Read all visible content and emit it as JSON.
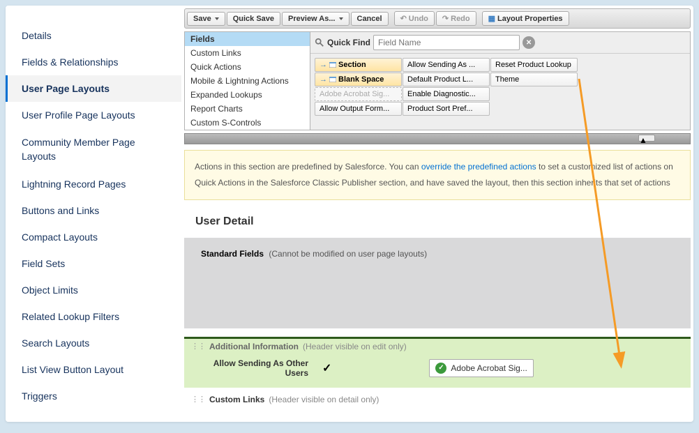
{
  "sidebar": {
    "items": [
      {
        "label": "Details",
        "active": false
      },
      {
        "label": "Fields & Relationships",
        "active": false
      },
      {
        "label": "User Page Layouts",
        "active": true
      },
      {
        "label": "User Profile Page Layouts",
        "active": false
      },
      {
        "label": "Community Member Page Layouts",
        "active": false,
        "multi": true
      },
      {
        "label": "Lightning Record Pages",
        "active": false
      },
      {
        "label": "Buttons and Links",
        "active": false
      },
      {
        "label": "Compact Layouts",
        "active": false
      },
      {
        "label": "Field Sets",
        "active": false
      },
      {
        "label": "Object Limits",
        "active": false
      },
      {
        "label": "Related Lookup Filters",
        "active": false
      },
      {
        "label": "Search Layouts",
        "active": false
      },
      {
        "label": "List View Button Layout",
        "active": false
      },
      {
        "label": "Triggers",
        "active": false
      }
    ]
  },
  "toolbar": {
    "save": "Save",
    "quick_save": "Quick Save",
    "preview_as": "Preview As...",
    "cancel": "Cancel",
    "undo": "Undo",
    "redo": "Redo",
    "layout_props": "Layout Properties"
  },
  "palette": {
    "categories": [
      "Fields",
      "Custom Links",
      "Quick Actions",
      "Mobile & Lightning Actions",
      "Expanded Lookups",
      "Report Charts",
      "Custom S-Controls"
    ],
    "quick_find_label": "Quick Find",
    "quick_find_placeholder": "Field Name",
    "fields_col1": [
      "Section",
      "Blank Space",
      "Adobe Acrobat Sig...",
      "Allow Output Form..."
    ],
    "fields_col2": [
      "Allow Sending As ...",
      "Default Product L...",
      "Enable Diagnostic...",
      "Product Sort Pref..."
    ],
    "fields_col3": [
      "Reset Product Lookup",
      "Theme"
    ]
  },
  "info_box": {
    "line1_pre": "Actions in this section are predefined by Salesforce. You can ",
    "link": "override the predefined actions",
    "line1_post": " to set a customized list of actions on",
    "line2": "Quick Actions in the Salesforce Classic Publisher section, and have saved the layout, then this section inherits that set of actions"
  },
  "detail": {
    "title": "User Detail",
    "std_header": "Standard Fields",
    "std_note": "(Cannot be modified on user page layouts)",
    "additional": {
      "title": "Additional Information",
      "note": "(Header visible on edit only)",
      "allow_label": "Allow Sending As Other Users",
      "drop_item": "Adobe Acrobat Sig..."
    },
    "custom_links": {
      "title": "Custom Links",
      "note": "(Header visible on detail only)"
    }
  }
}
